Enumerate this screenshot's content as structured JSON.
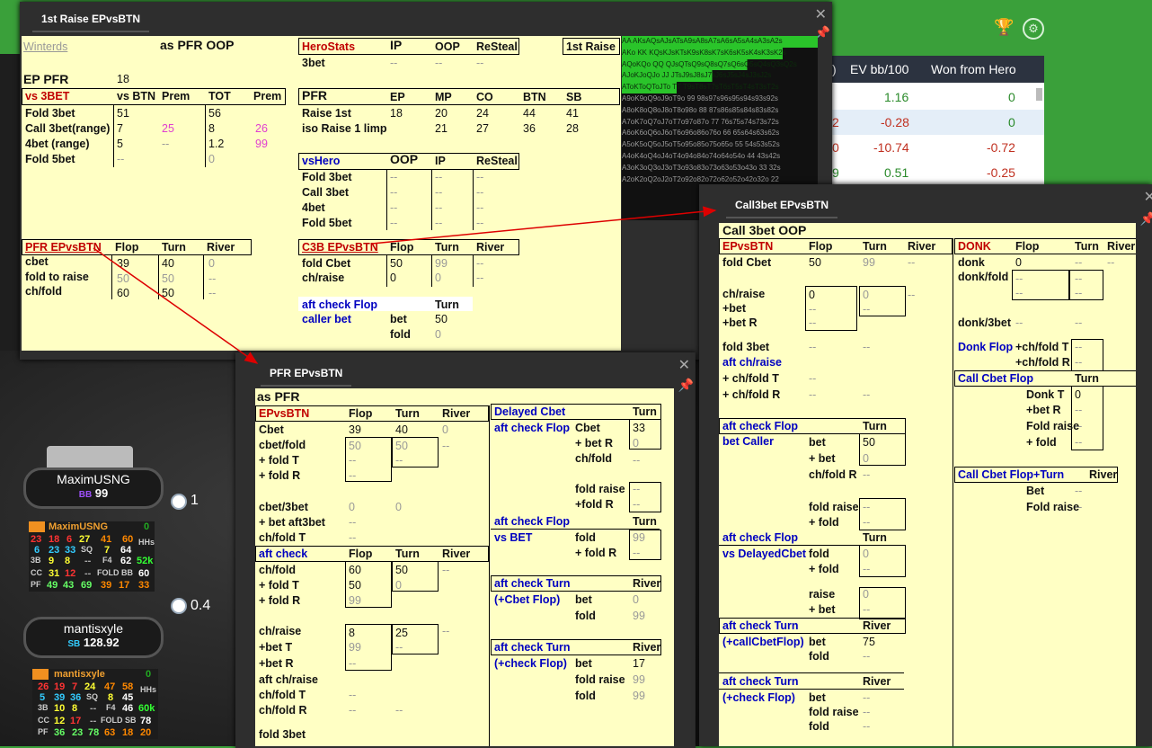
{
  "background": {
    "trophy_icon": "trophy-icon",
    "gear_icon": "gear-icon"
  },
  "stats_table": {
    "headers": [
      "EV bb/100",
      "Won from Hero"
    ],
    "rows": [
      {
        "ev": "1.16",
        "won": "0"
      },
      {
        "ev": "-0.28",
        "won": "0"
      },
      {
        "ev": "-10.74",
        "won": "-0.72"
      },
      {
        "ev": "0.51",
        "won": "-0.25"
      }
    ]
  },
  "win1": {
    "title": "1st Raise EPvsBTN",
    "player": "Winterds",
    "as_pfr_oop": "as PFR OOP",
    "ep_pfr_label": "EP PFR",
    "ep_pfr_value": "18",
    "vs3bet": {
      "title": "vs 3BET",
      "cols": [
        "vs BTN",
        "Prem",
        "TOT",
        "Prem"
      ],
      "rows": [
        [
          "Fold 3bet",
          "51",
          "",
          "56",
          ""
        ],
        [
          "Call 3bet(range)",
          "7",
          "25",
          "8",
          "26"
        ],
        [
          "4bet (range)",
          "5",
          "--",
          "1.2",
          "99"
        ],
        [
          "Fold 5bet",
          "--",
          "",
          "0",
          ""
        ]
      ]
    },
    "herostats": {
      "title": "HeroStats",
      "cols": [
        "IP",
        "OOP",
        "ReSteal"
      ],
      "row": [
        "3bet",
        "--",
        "--",
        "--"
      ]
    },
    "first_raise_btn": "1st Raise",
    "pfr": {
      "title": "PFR",
      "cols": [
        "EP",
        "MP",
        "CO",
        "BTN",
        "SB"
      ],
      "rows": [
        [
          "Raise 1st",
          "18",
          "20",
          "24",
          "44",
          "41"
        ],
        [
          "iso Raise 1 limp",
          "",
          "21",
          "27",
          "36",
          "28"
        ]
      ]
    },
    "vshero": {
      "title": "vsHero",
      "cols": [
        "OOP",
        "IP",
        "ReSteal"
      ],
      "rows": [
        "Fold 3bet",
        "Call 3bet",
        "4bet",
        "Fold 5bet"
      ]
    },
    "pfr_epvsbtn": {
      "title": "PFR EPvsBTN",
      "cols": [
        "Flop",
        "Turn",
        "River"
      ],
      "rows": [
        [
          "cbet",
          "39",
          "40",
          "0"
        ],
        [
          "fold to raise",
          "50",
          "50",
          "--"
        ],
        [
          "ch/fold",
          "60",
          "50",
          "--"
        ]
      ]
    },
    "c3b_epvsbtn": {
      "title": "C3B EPvsBTN",
      "cols": [
        "Flop",
        "Turn",
        "River"
      ],
      "rows": [
        [
          "fold Cbet",
          "50",
          "99",
          "--"
        ],
        [
          "ch/raise",
          "0",
          "0",
          "--"
        ]
      ]
    },
    "aft_check_flop": "aft check Flop",
    "caller_bet": "caller bet",
    "turn": "Turn",
    "bet": "bet",
    "fold": "fold",
    "bet_val": "50",
    "fold_val": "0"
  },
  "heatmap_rows": [
    "AA AKsAQsAJsATsA9sA8sA7sA6sA5sA4sA3sA2s",
    "AKo KK KQsKJsKTsK9sK8sK7sK6sK5sK4sK3sK2s",
    "AQoKQo QQ QJsQTsQ9sQ8sQ7sQ6sQ5sQ4sQ3sQ2s",
    "AJoKJoQJo JJ JTsJ9sJ8sJ7sJ6sJ5sJ4sJ3sJ2s",
    "AToKToQToJTo TT T9sT8sT7sT6sT5sT4sT3sT2s",
    "A9oK9oQ9oJ9oT9o 99 98s97s96s95s94s93s92s",
    "A8oK8oQ8oJ8oT8o98o 88 87s86s85s84s83s82s",
    "A7oK7oQ7oJ7oT7o97o87o 77 76s75s74s73s72s",
    "A6oK6oQ6oJ6oT6o96o86o76o 66 65s64s63s62s",
    "A5oK5oQ5oJ5oT5o95o85o75o65o 55 54s53s52s",
    "A4oK4oQ4oJ4oT4o94o84o74o64o54o 44 43s42s",
    "A3oK3oQ3oJ3oT3o93o83o73o63o53o43o 33 32s",
    "A2oK2oQ2oJ2oT2o92o82o72o62o52o42o32o 22"
  ],
  "players": [
    {
      "name": "MaximUSNG",
      "stack_prefix": "BB",
      "stack": "99",
      "chips": "1",
      "hud_name": "MaximUSNG",
      "hands": "0",
      "r1": [
        "23",
        "18",
        "6",
        "27",
        "41",
        "60"
      ],
      "r2": [
        "6",
        "23",
        "33",
        "SQ",
        "7",
        "64"
      ],
      "hhs": "HHs",
      "r3": [
        "3B",
        "9",
        "8",
        "--",
        "F4",
        "62"
      ],
      "hhs_val": "52k",
      "r4": [
        "CC",
        "31",
        "12",
        "--",
        "FOLD BB",
        "60"
      ],
      "r5": [
        "PF",
        "49",
        "43",
        "69",
        "39",
        "17",
        "33"
      ]
    },
    {
      "name": "mantisxyle",
      "stack_prefix": "SB",
      "stack": "128.92",
      "chips": "0.4",
      "hud_name": "mantisxyle",
      "hands": "0",
      "r1": [
        "26",
        "19",
        "7",
        "24",
        "47",
        "58"
      ],
      "r2": [
        "5",
        "39",
        "36",
        "SQ",
        "8",
        "45"
      ],
      "hhs": "HHs",
      "r3": [
        "3B",
        "10",
        "8",
        "--",
        "F4",
        "46"
      ],
      "hhs_val": "60k",
      "r4": [
        "CC",
        "12",
        "17",
        "--",
        "FOLD SB",
        "78"
      ],
      "r5": [
        "PF",
        "36",
        "23",
        "78",
        "63",
        "18",
        "20"
      ]
    }
  ],
  "win2": {
    "title": "PFR EPvsBTN",
    "as_pfr": "as PFR",
    "epvsbtn": "EPvsBTN",
    "cols": [
      "Flop",
      "Turn",
      "River"
    ],
    "cbet": [
      "Cbet",
      "39",
      "40",
      "0"
    ],
    "cbet_fold": [
      "cbet/fold",
      "50",
      "50",
      "--"
    ],
    "fold_t": "+ fold T",
    "fold_r": "+ fold R",
    "cbet_3bet": [
      "cbet/3bet",
      "0",
      "0"
    ],
    "bet_aft3bet": "+ bet aft3bet",
    "chfold_t": "ch/fold T",
    "aft_check": "aft check",
    "chfold": [
      "ch/fold",
      "60",
      "50",
      "--"
    ],
    "fold_t_v": "50",
    "fold_r_v": "99",
    "chraise": [
      "ch/raise",
      "8",
      "25",
      "--"
    ],
    "bet_t": "+bet T",
    "bet_r": "+bet R",
    "bet_t_v": "99",
    "aft_chraise": "aft ch/raise",
    "chfold_r": "ch/fold R",
    "fold3bet": "fold 3bet",
    "delayed_cbet": "Delayed Cbet",
    "turn": "Turn",
    "river": "River",
    "aft_check_flop": "aft check Flop",
    "cbet_lbl": "Cbet",
    "cbet_v": "33",
    "bet_r_lbl": "+ bet R",
    "bet_r_v": "0",
    "chfold_lbl": "ch/fold",
    "fold_raise": "fold raise",
    "fold_r2": "+fold R",
    "aft_check_flop2": "aft check Flop",
    "vs_bet": "vs BET",
    "fold": "fold",
    "fold_v": "99",
    "fold_r3": "+ fold R",
    "aft_check_turn": "aft check Turn",
    "cbet_flop": "(+Cbet Flop)",
    "bet": "bet",
    "bet_v": "0",
    "fold_v2": "99",
    "aft_check_turn2": "aft check Turn",
    "check_flop": "(+check Flop)",
    "bet_v2": "17",
    "fold_raise_v": "99",
    "fold_v3": "99"
  },
  "win3": {
    "title": "Call3bet EPvsBTN",
    "call3bet_oop": "Call 3bet OOP",
    "epvsbtn": "EPvsBTN",
    "cols": [
      "Flop",
      "Turn",
      "River"
    ],
    "fold_cbet": [
      "fold Cbet",
      "50",
      "99",
      "--"
    ],
    "chraise": "ch/raise",
    "chraise_v": "0",
    "chraise_t": "0",
    "bet": "+bet",
    "bet_r": "+bet R",
    "fold3bet": "fold 3bet",
    "aft_chraise": "aft ch/raise",
    "chfold_t": "+ ch/fold T",
    "chfold_r": "+ ch/fold R",
    "aft_check_flop": "aft check Flop",
    "bet_caller": "bet Caller",
    "turn": "Turn",
    "bet_lbl": "bet",
    "bet_v": "50",
    "bet2": "+ bet",
    "bet2_v": "0",
    "chfold_r2": "ch/fold R",
    "fold_raise": "fold raise",
    "fold_lbl": "+ fold",
    "aft_check_flop2": "aft check Flop",
    "vs_delayed": "vs DelayedCbet",
    "fold": "fold",
    "fold_v": "0",
    "fold2": "+ fold",
    "raise": "raise",
    "raise_v": "0",
    "bet3": "+ bet",
    "aft_check_turn": "aft check Turn",
    "river": "River",
    "call_cbet": "(+callCbetFlop)",
    "bet4": "bet",
    "bet4_v": "75",
    "fold3": "fold",
    "aft_check_turn2": "aft check Turn",
    "check_flop": "(+check Flop)",
    "bet5": "bet",
    "fold_raise2": "fold raise",
    "fold4": "fold",
    "donk": "DONK",
    "donk_cols": [
      "Flop",
      "Turn",
      "River"
    ],
    "donk_row": [
      "donk",
      "0",
      "--",
      "--"
    ],
    "donk_fold": "donk/fold",
    "donk_3bet": "donk/3bet",
    "donk_flop": "Donk Flop",
    "chfold_t2": "+ch/fold T",
    "chfold_r3": "+ch/fold R",
    "call_cbet_flop": "Call Cbet Flop",
    "donk_t": "Donk T",
    "donk_t_v": "0",
    "bet_r2": "+bet R",
    "fold_raise3": "Fold raise",
    "fold5": "+ fold",
    "call_cbet_turn": "Call Cbet Flop+Turn",
    "bet6": "Bet",
    "fold_raise4": "Fold raise"
  }
}
